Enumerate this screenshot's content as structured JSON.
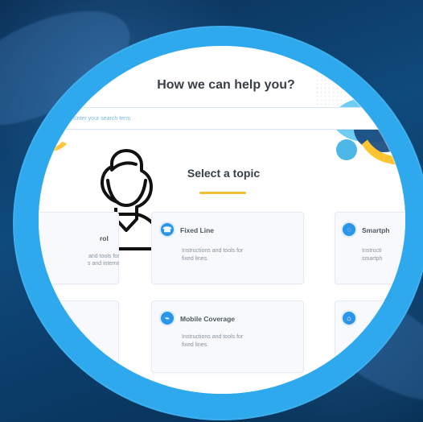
{
  "page": {
    "title": "How we can help you?",
    "search_placeholder": "Enter your search term"
  },
  "sections": {
    "topic_title": "Select a topic"
  },
  "cards": {
    "left_top": {
      "title": "rol",
      "desc_line1": "and tools for",
      "desc_line2": "s and internet."
    },
    "middle_top": {
      "title": "Fixed Line",
      "desc_line1": "Instructions and tools for",
      "desc_line2": "fixed lines."
    },
    "right_top": {
      "title": "Smartph",
      "desc_line1": "Instructi",
      "desc_line2": "smartph"
    },
    "middle_bottom": {
      "title": "Mobile Coverage",
      "desc_line1": "Instructions and tools for",
      "desc_line2": "fixed lines."
    }
  },
  "icons": {
    "avatar": "user-avatar-icon",
    "search": "search-icon",
    "fixed_line": "phone-icon",
    "mobile_coverage": "signal-icon",
    "smartphone": "smartphone-icon",
    "home": "home-icon"
  },
  "colors": {
    "background": "#0b3a63",
    "ring": "#2ea9ed",
    "accent_blue": "#2b95ea",
    "accent_yellow": "#f4be34",
    "title_text": "#393f47"
  }
}
